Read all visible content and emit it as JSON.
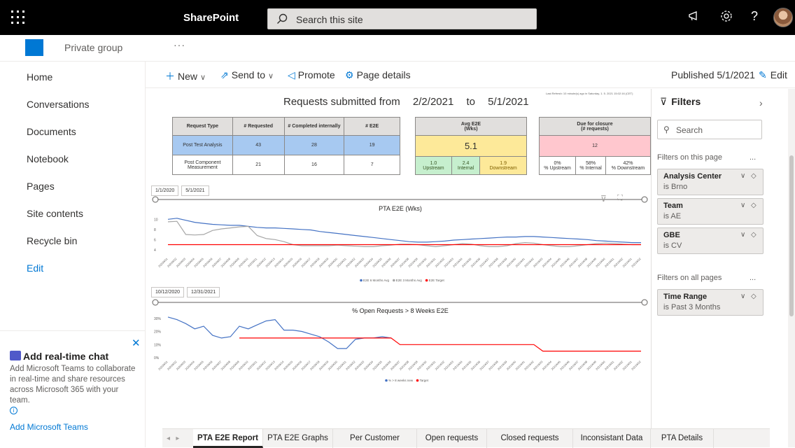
{
  "suite": {
    "brand": "SharePoint",
    "search_placeholder": "Search this site"
  },
  "hub": {
    "group_label": "Private group",
    "more": "···"
  },
  "nav": {
    "items": [
      "Home",
      "Conversations",
      "Documents",
      "Notebook",
      "Pages",
      "Site contents",
      "Recycle bin"
    ],
    "edit": "Edit"
  },
  "chat": {
    "title": "Add real-time chat",
    "desc": "Add Microsoft Teams to collaborate in real-time and share resources across Microsoft 365 with your team.",
    "link": "Add Microsoft Teams"
  },
  "commands": {
    "new": "New",
    "send_to": "Send to",
    "promote": "Promote",
    "page_details": "Page details",
    "published": "Published 5/1/2021",
    "edit": "Edit"
  },
  "report": {
    "title_prefix": "Requests submitted from",
    "date_from": "2/2/2021",
    "to": "to",
    "date_to": "5/1/2021",
    "last_refresh": "Last Refresh: 10 minute(s) ago in Saturday, 1. 5. 2021 15:02:16 (CET)",
    "table": {
      "headers": [
        "Request Type",
        "# Requested",
        "# Completed internally",
        "# E2E"
      ],
      "rows": [
        [
          "Post Test Analysis",
          "43",
          "28",
          "19"
        ],
        [
          "Post Component Measurement",
          "21",
          "16",
          "7"
        ]
      ]
    },
    "avg": {
      "title": "Avg E2E",
      "sub": "(Wks)",
      "value": "5.1",
      "parts": [
        {
          "v": "1.0",
          "l": "Upstream"
        },
        {
          "v": "2.4",
          "l": "Internal"
        },
        {
          "v": "1.9",
          "l": "Downstream"
        }
      ]
    },
    "due": {
      "title": "Due for closure",
      "sub": "(# requests)",
      "value": "12",
      "parts": [
        {
          "v": "0%",
          "l": "% Upstream"
        },
        {
          "v": "58%",
          "l": "% Internal"
        },
        {
          "v": "42%",
          "l": "% Downstream"
        }
      ]
    },
    "slicer1": {
      "from": "1/1/2020",
      "to": "5/1/2021"
    },
    "slicer2": {
      "from": "10/12/2020",
      "to": "12/31/2021"
    },
    "legend1": [
      "E2E 6 Months Avg",
      "E2E 3 Months Avg",
      "E2E Target"
    ],
    "legend2": [
      "% > 8 weeks new",
      "Target"
    ]
  },
  "chart_data": [
    {
      "type": "line",
      "title": "PTA E2E (Wks)",
      "ylim": [
        3,
        11
      ],
      "yticks": [
        4,
        6,
        8,
        10
      ],
      "series": [
        {
          "name": "E2E 6 Months Avg",
          "color": "#4472c4",
          "values": [
            10,
            10.2,
            9.8,
            9.4,
            9.2,
            9,
            8.9,
            8.8,
            8.8,
            8.6,
            8.4,
            8.3,
            8.3,
            8.2,
            8.1,
            8.0,
            7.9,
            7.6,
            7.4,
            7.2,
            7.0,
            6.8,
            6.6,
            6.4,
            6.2,
            6.0,
            5.8,
            5.6,
            5.5,
            5.5,
            5.6,
            5.7,
            5.9,
            6.0,
            6.1,
            6.2,
            6.3,
            6.4,
            6.5,
            6.5,
            6.6,
            6.6,
            6.5,
            6.4,
            6.3,
            6.2,
            6.1,
            6.0,
            5.8,
            5.7,
            5.6,
            5.5,
            5.4,
            5.4
          ]
        },
        {
          "name": "E2E 3 Months Avg",
          "color": "#a6a6a6",
          "values": [
            9.5,
            9.6,
            7.0,
            6.9,
            7.0,
            7.8,
            8.1,
            8.3,
            8.5,
            8.6,
            6.8,
            6.2,
            6.0,
            5.6,
            5.0,
            4.8,
            4.8,
            4.8,
            4.8,
            4.9,
            4.8,
            4.7,
            4.6,
            4.6,
            4.8,
            4.9,
            5.1,
            5.1,
            5.0,
            4.8,
            4.6,
            4.8,
            5.0,
            5.2,
            5.1,
            4.8,
            4.6,
            4.6,
            4.8,
            5.2,
            5.4,
            5.3,
            5.0,
            4.8,
            4.6,
            4.6,
            4.8,
            5.0,
            5.2,
            5.3,
            5.2,
            5.1,
            5.0,
            5.0
          ]
        },
        {
          "name": "E2E Target",
          "color": "#ff0000",
          "values": [
            5,
            5,
            5,
            5,
            5,
            5,
            5,
            5,
            5,
            5,
            5,
            5,
            5,
            5,
            5,
            5,
            5,
            5,
            5,
            5,
            5,
            5,
            5,
            5,
            5,
            5,
            5,
            5,
            5,
            5,
            5,
            5,
            5,
            5,
            5,
            5,
            5,
            5,
            5,
            5,
            5,
            5,
            5,
            5,
            5,
            5,
            5,
            5,
            5,
            5,
            5,
            5,
            5,
            5
          ]
        }
      ]
    },
    {
      "type": "line",
      "title": "% Open Requests > 8 Weeks E2E",
      "ylim": [
        0,
        32
      ],
      "yticks": [
        "0%",
        "10%",
        "20%",
        "30%"
      ],
      "series": [
        {
          "name": "% > 8 weeks new",
          "color": "#4472c4",
          "values": [
            31,
            29,
            26,
            22,
            24,
            17,
            15,
            16,
            24,
            22,
            25,
            28,
            29,
            21,
            21,
            20,
            18,
            16,
            12,
            7,
            7,
            14,
            15,
            15,
            16,
            15,
            null,
            null,
            null,
            null,
            null,
            null,
            null,
            null,
            null,
            null,
            null,
            null,
            null,
            null,
            null,
            null,
            null,
            null,
            null,
            null,
            null,
            null,
            null,
            null,
            null,
            null,
            null,
            null
          ]
        },
        {
          "name": "Target",
          "color": "#ff0000",
          "values": [
            null,
            null,
            null,
            null,
            null,
            null,
            null,
            null,
            15,
            15,
            15,
            15,
            15,
            15,
            15,
            15,
            15,
            15,
            15,
            15,
            15,
            15,
            15,
            15,
            15,
            15,
            10,
            10,
            10,
            10,
            10,
            10,
            10,
            10,
            10,
            10,
            10,
            10,
            10,
            10,
            10,
            10,
            5,
            5,
            5,
            5,
            5,
            5,
            5,
            5,
            5,
            5,
            5,
            5
          ]
        }
      ]
    }
  ],
  "filters": {
    "title": "Filters",
    "search": "Search",
    "on_page": "Filters on this page",
    "on_all": "Filters on all pages",
    "more": "...",
    "cards_page": [
      {
        "name": "Analysis Center",
        "value": "is Brno"
      },
      {
        "name": "Team",
        "value": "is AE"
      },
      {
        "name": "GBE",
        "value": "is CV"
      }
    ],
    "cards_all": [
      {
        "name": "Time Range",
        "value": "is Past 3 Months"
      }
    ]
  },
  "tabs": [
    "PTA E2E Report",
    "PTA E2E Graphs",
    "Per Customer",
    "Open requests",
    "Closed requests",
    "Inconsistant Data",
    "PTA Details"
  ],
  "active_tab": "PTA E2E Report"
}
